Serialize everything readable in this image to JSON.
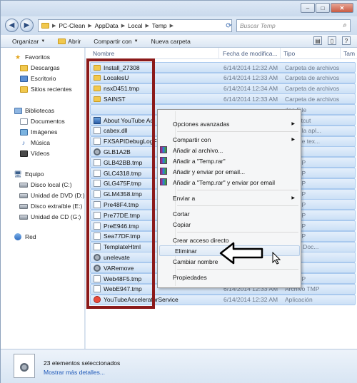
{
  "window": {
    "min": "–",
    "max": "□",
    "close": "✕"
  },
  "breadcrumb": [
    "PC-Clean",
    "AppData",
    "Local",
    "Temp"
  ],
  "search": {
    "placeholder": "Buscar Temp"
  },
  "toolbar": {
    "organize": "Organizar",
    "open": "Abrir",
    "share": "Compartir con",
    "newfolder": "Nueva carpeta"
  },
  "columns": {
    "name": "Nombre",
    "date": "Fecha de modifica...",
    "type": "Tipo",
    "size": "Tam"
  },
  "sidebar": {
    "favorites": "Favoritos",
    "fav_items": [
      "Descargas",
      "Escritorio",
      "Sitios recientes"
    ],
    "libraries": "Bibliotecas",
    "lib_items": [
      "Documentos",
      "Imágenes",
      "Música",
      "Vídeos"
    ],
    "computer": "Equipo",
    "comp_items": [
      "Disco local (C:)",
      "Unidad de DVD (D:)",
      "Disco extraíble (E:)",
      "Unidad de CD (G:)"
    ],
    "network": "Red"
  },
  "files": [
    {
      "name": "Install_27308",
      "date": "6/14/2014 12:32 AM",
      "type": "Carpeta de archivos",
      "icon": "folder"
    },
    {
      "name": "LocalesU",
      "date": "6/14/2014 12:33 AM",
      "type": "Carpeta de archivos",
      "icon": "folder"
    },
    {
      "name": "nsxD451.tmp",
      "date": "6/14/2014 12:34 AM",
      "type": "Carpeta de archivos",
      "icon": "folder"
    },
    {
      "name": "SAINST",
      "date": "6/14/2014 12:33 AM",
      "type": "Carpeta de archivos",
      "icon": "folder"
    },
    {
      "name": "",
      "date": "",
      "type": "deo File",
      "icon": "none"
    },
    {
      "name": "About YouTube Ac",
      "date": "",
      "type": "t Shortcut",
      "icon": "app"
    },
    {
      "name": "cabex.dll",
      "date": "",
      "type": "ón de la apl...",
      "icon": "file"
    },
    {
      "name": "FXSAPIDebugLogF",
      "date": "",
      "type": "ento de tex...",
      "icon": "file"
    },
    {
      "name": "GLB1A2B",
      "date": "",
      "type": "ión",
      "icon": "gear"
    },
    {
      "name": "GLB42BB.tmp",
      "date": "",
      "type": "vo TMP",
      "icon": "file"
    },
    {
      "name": "GLC4318.tmp",
      "date": "",
      "type": "vo TMP",
      "icon": "file"
    },
    {
      "name": "GLG475F.tmp",
      "date": "",
      "type": "vo TMP",
      "icon": "file"
    },
    {
      "name": "GLM4358.tmp",
      "date": "",
      "type": "vo TMP",
      "icon": "file"
    },
    {
      "name": "Pre48F4.tmp",
      "date": "",
      "type": "vo TMP",
      "icon": "file"
    },
    {
      "name": "Pre77DE.tmp",
      "date": "",
      "type": "vo TMP",
      "icon": "file"
    },
    {
      "name": "PreE946.tmp",
      "date": "",
      "type": "vo TMP",
      "icon": "file"
    },
    {
      "name": "Sea77DF.tmp",
      "date": "",
      "type": "vo TMP",
      "icon": "file"
    },
    {
      "name": "TemplateHtml",
      "date": "",
      "type": "HTML Doc...",
      "icon": "file"
    },
    {
      "name": "unelevate",
      "date": "",
      "type": "ión",
      "icon": "gear"
    },
    {
      "name": "VARemove",
      "date": "",
      "type": "ión",
      "icon": "gear"
    },
    {
      "name": "Web48F5.tmp",
      "date": "",
      "type": "vo TMP",
      "icon": "file"
    },
    {
      "name": "WebE947.tmp",
      "date": "6/14/2014 12:33 AM",
      "type": "Archivo TMP",
      "icon": "file"
    },
    {
      "name": "YouTubeAcceleratorService",
      "date": "6/14/2014 12:32 AM",
      "type": "Aplicación",
      "icon": "red"
    }
  ],
  "context_menu": [
    {
      "label": "Opciones avanzadas",
      "submenu": true,
      "icon": ""
    },
    {
      "sep": true
    },
    {
      "label": "Compartir con",
      "submenu": true,
      "icon": ""
    },
    {
      "label": "Añadir al archivo...",
      "icon": "rar"
    },
    {
      "label": "Añadir a \"Temp.rar\"",
      "icon": "rar"
    },
    {
      "label": "Añadir y enviar por email...",
      "icon": "rar"
    },
    {
      "label": "Añadir a \"Temp.rar\" y enviar por email",
      "icon": "rar"
    },
    {
      "sep": true
    },
    {
      "label": "Enviar a",
      "submenu": true,
      "icon": ""
    },
    {
      "sep": true
    },
    {
      "label": "Cortar",
      "icon": ""
    },
    {
      "label": "Copiar",
      "icon": ""
    },
    {
      "sep": true
    },
    {
      "label": "Crear acceso directo",
      "icon": ""
    },
    {
      "label": "Eliminar",
      "icon": "",
      "highlight": true
    },
    {
      "label": "Cambiar nombre",
      "icon": ""
    },
    {
      "sep": true
    },
    {
      "label": "Propiedades",
      "icon": ""
    }
  ],
  "details": {
    "title": "23 elementos seleccionados",
    "link": "Mostrar más detalles..."
  },
  "colors": {
    "selection_box": "#8b1a1a",
    "row_selected": "#cce0f6",
    "link": "#1e58b8"
  }
}
